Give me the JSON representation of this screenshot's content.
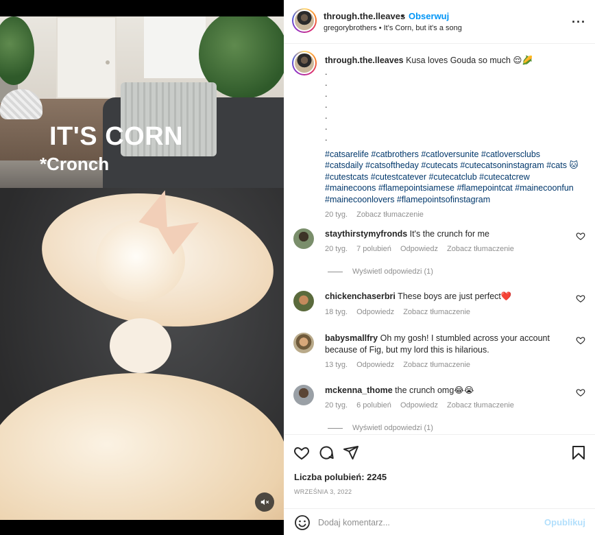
{
  "media": {
    "overlay_title": "IT'S CORN",
    "overlay_subtitle": "*Cronch",
    "mute_icon": "speaker-muted-icon"
  },
  "header": {
    "username": "through.the.lleaves",
    "separator": "•",
    "follow_label": "Obserwuj",
    "audio": "gregorybrothers • It's Corn, but it's a song",
    "more_icon": "more-horizontal-icon"
  },
  "caption": {
    "username": "through.the.lleaves",
    "text": "Kusa loves Gouda so much 😌🌽",
    "dots": [
      ".",
      ".",
      ".",
      ".",
      ".",
      ".",
      "."
    ],
    "hashtags": "#catsarelife #catbrothers #catloversunite #catloversclubs #catsdaily #catsoftheday #cutecats #cutecatsoninstagram #cats 🐱 #cutestcats #cutestcatever #cutecatclub #cutecatcrew #mainecoons #flamepointsiamese #flamepointcat #mainecoonfun #mainecoonlovers #flamepointsofinstagram",
    "time": "20 tyg.",
    "translate": "Zobacz tłumaczenie"
  },
  "comments": [
    {
      "username": "staythirstymyfronds",
      "text": "It's the crunch for me",
      "time": "20 tyg.",
      "likes": "7 polubień",
      "reply": "Odpowiedz",
      "translate": "Zobacz tłumaczenie",
      "view_replies": "Wyświetl odpowiedzi (1)"
    },
    {
      "username": "chickenchaserbri",
      "text": "These boys are just perfect❤️",
      "time": "18 tyg.",
      "reply": "Odpowiedz",
      "translate": "Zobacz tłumaczenie"
    },
    {
      "username": "babysmallfry",
      "text": "Oh my gosh! I stumbled across your account because of Fig, but my lord this is hilarious.",
      "time": "13 tyg.",
      "reply": "Odpowiedz",
      "translate": "Zobacz tłumaczenie"
    },
    {
      "username": "mckenna_thome",
      "text": "the crunch omg😂😭",
      "time": "20 tyg.",
      "likes": "6 polubień",
      "reply": "Odpowiedz",
      "translate": "Zobacz tłumaczenie",
      "view_replies": "Wyświetl odpowiedzi (1)"
    }
  ],
  "actions": {
    "icons": [
      "heart-icon",
      "comment-icon",
      "share-icon",
      "bookmark-icon"
    ],
    "likes_label": "Liczba polubień: 2245",
    "date": "WRZEŚNIA 3, 2022"
  },
  "composer": {
    "placeholder": "Dodaj komentarz...",
    "post_label": "Opublikuj"
  }
}
